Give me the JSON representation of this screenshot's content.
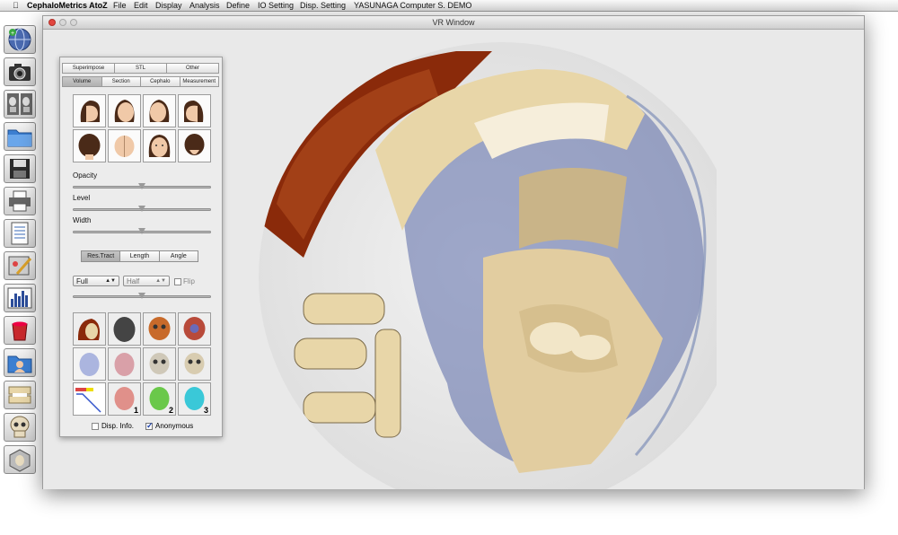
{
  "menubar": {
    "app_name": "CephaloMetrics AtoZ",
    "apple": "",
    "items": [
      "File",
      "Edit",
      "Display",
      "Analysis",
      "Define",
      "IO Setting",
      "Disp. Setting",
      "YASUNAGA Computer S. DEMO"
    ]
  },
  "tools": [
    {
      "name": "globe-icon"
    },
    {
      "name": "camera-icon"
    },
    {
      "name": "xray-compare-icon"
    },
    {
      "name": "folder-open-icon"
    },
    {
      "name": "save-disk-icon"
    },
    {
      "name": "printer-icon"
    },
    {
      "name": "report-list-icon"
    },
    {
      "name": "edit-image-icon"
    },
    {
      "name": "chart-icon"
    },
    {
      "name": "paint-bucket-icon"
    },
    {
      "name": "patient-folder-icon"
    },
    {
      "name": "model-cast-icon"
    },
    {
      "name": "skull-icon"
    },
    {
      "name": "superimpose-box-icon"
    }
  ],
  "window": {
    "title": "VR Window"
  },
  "panel": {
    "tabs_row1": [
      "Superimpose",
      "STL",
      "Other"
    ],
    "tabs_row2": [
      "Volume",
      "Section",
      "Cephalo",
      "Measurement"
    ],
    "selected_tab": "Volume",
    "slider_opacity_label": "Opacity",
    "slider_level_label": "Level",
    "slider_width_label": "Width",
    "sliders": {
      "opacity": 0.5,
      "level": 0.5,
      "width": 0.5,
      "extra": 0.5
    },
    "segments": [
      "Res.Tract",
      "Length",
      "Angle"
    ],
    "selected_segment": "Res.Tract",
    "popup_full": "Full",
    "popup_half": "Half",
    "flip_label": "Flip",
    "flip_checked": false,
    "preset_numbers": [
      "1",
      "2",
      "3"
    ],
    "disp_info_label": "Disp. Info.",
    "disp_info_checked": false,
    "anonymous_label": "Anonymous",
    "anonymous_checked": true
  },
  "colors": {
    "accent": "#3b74d6",
    "skin": "#f0c9a8",
    "bone": "#e8d6a8",
    "soft_tissue_blue": "#5a6aa8",
    "volume_red": "#8a2a0a"
  }
}
